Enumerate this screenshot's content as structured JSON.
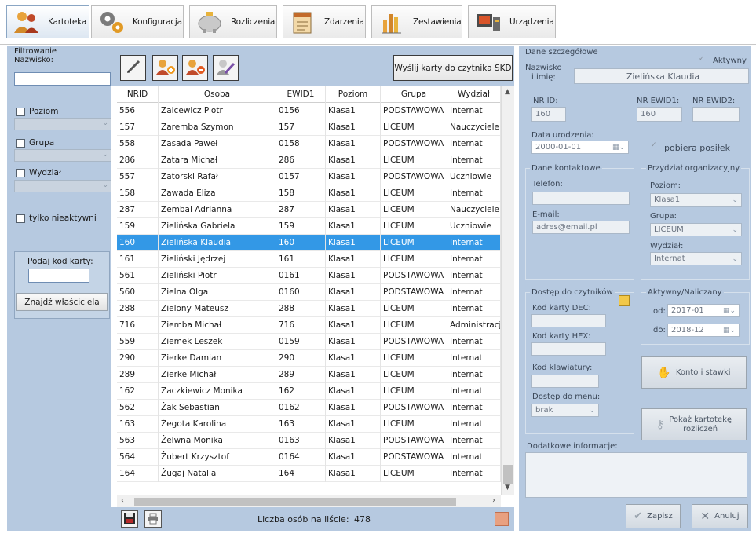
{
  "toolbar": {
    "tabs": [
      {
        "label": "Kartoteka",
        "icon": "users-icon"
      },
      {
        "label": "Konfiguracja",
        "icon": "gears-icon"
      },
      {
        "label": "Rozliczenia",
        "icon": "piggy-bank-icon"
      },
      {
        "label": "Zdarzenia",
        "icon": "calendar-icon"
      },
      {
        "label": "Zestawienia",
        "icon": "bar-chart-icon"
      },
      {
        "label": "Urządzenia",
        "icon": "devices-icon"
      }
    ]
  },
  "filter": {
    "title": "Filtrowanie",
    "surname_label": "Nazwisko:",
    "surname_value": "",
    "level_label": "Poziom",
    "group_label": "Grupa",
    "dept_label": "Wydział",
    "inactive_label": "tylko nieaktywni",
    "card_label": "Podaj kod karty:",
    "card_value": "",
    "find_owner": "Znajdź właściciela"
  },
  "actions": {
    "skd_button": "Wyślij karty do czytnika SKD"
  },
  "grid": {
    "columns": [
      "NRID",
      "Osoba",
      "EWID1",
      "Poziom",
      "Grupa",
      "Wydział"
    ],
    "selected_index": 8,
    "rows": [
      [
        "556",
        "Zalcewicz Piotr",
        "0156",
        "Klasa1",
        "PODSTAWOWA",
        "Internat"
      ],
      [
        "157",
        "Zaremba Szymon",
        "157",
        "Klasa1",
        "LICEUM",
        "Nauczyciele"
      ],
      [
        "558",
        "Zasada Paweł",
        "0158",
        "Klasa1",
        "PODSTAWOWA",
        "Internat"
      ],
      [
        "286",
        "Zatara Michał",
        "286",
        "Klasa1",
        "LICEUM",
        "Internat"
      ],
      [
        "557",
        "Zatorski Rafał",
        "0157",
        "Klasa1",
        "PODSTAWOWA",
        "Uczniowie"
      ],
      [
        "158",
        "Zawada Eliza",
        "158",
        "Klasa1",
        "LICEUM",
        "Internat"
      ],
      [
        "287",
        "Zembal Adrianna",
        "287",
        "Klasa1",
        "LICEUM",
        "Nauczyciele"
      ],
      [
        "159",
        "Zielińska Gabriela",
        "159",
        "Klasa1",
        "LICEUM",
        "Uczniowie"
      ],
      [
        "160",
        "Zielińska Klaudia",
        "160",
        "Klasa1",
        "LICEUM",
        "Internat"
      ],
      [
        "161",
        "Zieliński Jędrzej",
        "161",
        "Klasa1",
        "LICEUM",
        "Internat"
      ],
      [
        "561",
        "Zieliński Piotr",
        "0161",
        "Klasa1",
        "PODSTAWOWA",
        "Internat"
      ],
      [
        "560",
        "Zielna Olga",
        "0160",
        "Klasa1",
        "PODSTAWOWA",
        "Internat"
      ],
      [
        "288",
        "Zielony Mateusz",
        "288",
        "Klasa1",
        "LICEUM",
        "Internat"
      ],
      [
        "716",
        "Ziemba Michał",
        "716",
        "Klasa1",
        "LICEUM",
        "Administracja"
      ],
      [
        "559",
        "Ziemek Leszek",
        "0159",
        "Klasa1",
        "PODSTAWOWA",
        "Internat"
      ],
      [
        "290",
        "Zierke Damian",
        "290",
        "Klasa1",
        "LICEUM",
        "Internat"
      ],
      [
        "289",
        "Zierke Michał",
        "289",
        "Klasa1",
        "LICEUM",
        "Internat"
      ],
      [
        "162",
        "Zaczkiewicz Monika",
        "162",
        "Klasa1",
        "LICEUM",
        "Internat"
      ],
      [
        "562",
        "Żak Sebastian",
        "0162",
        "Klasa1",
        "PODSTAWOWA",
        "Internat"
      ],
      [
        "163",
        "Żegota Karolina",
        "163",
        "Klasa1",
        "LICEUM",
        "Internat"
      ],
      [
        "563",
        "Żelwna Monika",
        "0163",
        "Klasa1",
        "PODSTAWOWA",
        "Internat"
      ],
      [
        "564",
        "Żubert Krzysztof",
        "0164",
        "Klasa1",
        "PODSTAWOWA",
        "Internat"
      ],
      [
        "164",
        "Żugaj Natalia",
        "164",
        "Klasa1",
        "LICEUM",
        "Internat"
      ]
    ]
  },
  "footer": {
    "count_label": "Liczba osób na liście:",
    "count_value": "478"
  },
  "details": {
    "title": "Dane szczegółowe",
    "active_label": "Aktywny",
    "name_label_1": "Nazwisko",
    "name_label_2": "i imię:",
    "name_value": "Zielińska Klaudia",
    "nrid_label": "NR ID:",
    "nrid_value": "160",
    "ewid1_label": "NR EWID1:",
    "ewid1_value": "160",
    "ewid2_label": "NR EWID2:",
    "ewid2_value": "",
    "birth_label": "Data urodzenia:",
    "birth_value": "2000-01-01",
    "meal_label": "pobiera posiłek",
    "contact_title": "Dane kontaktowe",
    "phone_label": "Telefon:",
    "phone_value": "",
    "email_label": "E-mail:",
    "email_value": "adres@email.pl",
    "org_title": "Przydział organizacyjny",
    "org_level_label": "Poziom:",
    "org_level_value": "Klasa1",
    "org_group_label": "Grupa:",
    "org_group_value": "LICEUM",
    "org_dept_label": "Wydział:",
    "org_dept_value": "Internat",
    "access_title": "Dostęp do czytników",
    "dec_label": "Kod karty DEC:",
    "hex_label": "Kod karty HEX:",
    "keyboard_label": "Kod klawiatury:",
    "menu_label": "Dostęp do menu:",
    "menu_value": "brak",
    "period_title": "Aktywny/Naliczany",
    "from_label": "od:",
    "from_value": "2017-01",
    "to_label": "do:",
    "to_value": "2018-12",
    "account_button": "Konto i stawki",
    "show_card_1": "Pokaż kartotekę",
    "show_card_2": "rozliczeń",
    "extra_label": "Dodatkowe informacje:",
    "save_button": "Zapisz",
    "cancel_button": "Anuluj"
  }
}
